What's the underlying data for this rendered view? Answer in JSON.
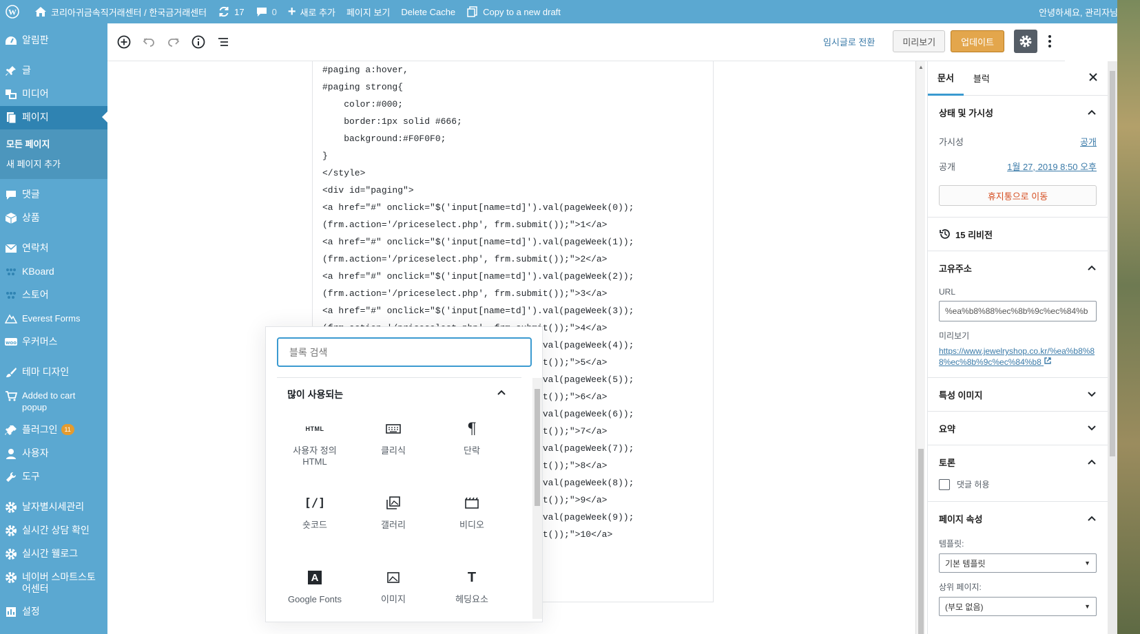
{
  "admin_bar": {
    "site_name": "코리아귀금속직거래센터 / 한국금거래센터",
    "updates_count": "17",
    "comments_count": "0",
    "new_label": "새로 추가",
    "view_page": "페이지 보기",
    "delete_cache": "Delete Cache",
    "copy_draft": "Copy to a new draft",
    "greeting": "안녕하세요, 관리자님"
  },
  "sidebar": {
    "items": [
      {
        "label": "알림판",
        "icon": "dashboard-icon"
      },
      {
        "label": "글",
        "icon": "pin-icon"
      },
      {
        "label": "미디어",
        "icon": "media-icon"
      },
      {
        "label": "페이지",
        "icon": "page-icon"
      },
      {
        "label": "댓글",
        "icon": "comment-icon"
      },
      {
        "label": "상품",
        "icon": "box-icon"
      },
      {
        "label": "연락처",
        "icon": "mail-icon"
      },
      {
        "label": "KBoard",
        "icon": "dots-icon"
      },
      {
        "label": "스토어",
        "icon": "dots-icon"
      },
      {
        "label": "Everest Forms",
        "icon": "forms-icon"
      },
      {
        "label": "우커머스",
        "icon": "woo-icon"
      },
      {
        "label": "테마 디자인",
        "icon": "brush-icon"
      },
      {
        "label": "Added to cart popup",
        "icon": "cart-icon"
      },
      {
        "label": "플러그인",
        "icon": "plugin-icon",
        "badge": "11"
      },
      {
        "label": "사용자",
        "icon": "user-icon"
      },
      {
        "label": "도구",
        "icon": "wrench-icon"
      },
      {
        "label": "날자별시세관리",
        "icon": "gear-icon"
      },
      {
        "label": "실시간 상담 확인",
        "icon": "gear-icon"
      },
      {
        "label": "실시간 웰로그",
        "icon": "gear-icon"
      },
      {
        "label": "네이버 스마트스토어센터",
        "icon": "gear-icon"
      },
      {
        "label": "설정",
        "icon": "settings-icon"
      }
    ],
    "submenu": [
      "모든 페이지",
      "새 페이지 추가"
    ]
  },
  "toolbar": {
    "switch_draft": "임시글로 전환",
    "preview": "미리보기",
    "update": "업데이트"
  },
  "code_lines": [
    "#paging a:hover,",
    "#paging strong{",
    "    color:#000;",
    "    border:1px solid #666;",
    "    background:#F0F0F0;",
    "}",
    "</style>",
    "<div id=\"paging\">",
    "<a href=\"#\" onclick=\"$('input[name=td]').val(pageWeek(0));",
    "(frm.action='/priceselect.php', frm.submit());\">1</a>",
    "<a href=\"#\" onclick=\"$('input[name=td]').val(pageWeek(1));",
    "(frm.action='/priceselect.php', frm.submit());\">2</a>",
    "<a href=\"#\" onclick=\"$('input[name=td]').val(pageWeek(2));",
    "(frm.action='/priceselect.php', frm.submit());\">3</a>",
    "<a href=\"#\" onclick=\"$('input[name=td]').val(pageWeek(3));",
    "(frm.action='/priceselect.php', frm.submit());\">4</a>",
    "<a href=\"#\" onclick=\"$('input[name=td]').val(pageWeek(4));",
    "(frm.action='/priceselect.php', frm.submit());\">5</a>",
    "<a href=\"#\" onclick=\"$('input[name=td]').val(pageWeek(5));",
    "(frm.action='/priceselect.php', frm.submit());\">6</a>",
    "<a href=\"#\" onclick=\"$('input[name=td]').val(pageWeek(6));",
    "(frm.action='/priceselect.php', frm.submit());\">7</a>",
    "<a href=\"#\" onclick=\"$('input[name=td]').val(pageWeek(7));",
    "(frm.action='/priceselect.php', frm.submit());\">8</a>",
    "<a href=\"#\" onclick=\"$('input[name=td]').val(pageWeek(8));",
    "(frm.action='/priceselect.php', frm.submit());\">9</a>",
    "<a href=\"#\" onclick=\"$('input[name=td]').val(pageWeek(9));",
    "(frm.action='/priceselect.php', frm.submit());\">10</a>"
  ],
  "inserter": {
    "search_placeholder": "블록 검색",
    "panel_title": "많이 사용되는",
    "blocks": [
      {
        "label": "사용자 정의 HTML",
        "icon": "html-icon"
      },
      {
        "label": "클리식",
        "icon": "keyboard-icon"
      },
      {
        "label": "단락",
        "icon": "paragraph-icon"
      },
      {
        "label": "숏코드",
        "icon": "shortcode-icon"
      },
      {
        "label": "갤러리",
        "icon": "gallery-icon"
      },
      {
        "label": "비디오",
        "icon": "video-icon"
      },
      {
        "label": "Google Fonts",
        "icon": "font-a-icon"
      },
      {
        "label": "이미지",
        "icon": "image-icon"
      },
      {
        "label": "헤딩요소",
        "icon": "heading-icon"
      }
    ]
  },
  "inspector": {
    "tab_document": "문서",
    "tab_block": "블럭",
    "status_title": "상태 및 가시성",
    "visibility_label": "가시성",
    "visibility_value": "공개",
    "publish_label": "공개",
    "publish_value": "1월 27, 2019 8:50 오후",
    "trash": "휴지통으로 이동",
    "revisions": "15 리비전",
    "permalink_title": "고유주소",
    "url_label": "URL",
    "url_value": "%ea%b8%88%ec%8b%9c%ec%84%b",
    "preview_label": "미리보기",
    "preview_link": "https://www.jewelryshop.co.kr/%ea%b8%88%ec%8b%9c%ec%84%b8",
    "featured_image": "특성 이미지",
    "excerpt": "요약",
    "discussion": "토론",
    "allow_comments": "댓글 허용",
    "page_attributes": "페이지 속성",
    "template_label": "템플릿:",
    "template_value": "기본 템플릿",
    "parent_label": "상위 페이지:",
    "parent_value": "(부모 없음)"
  }
}
